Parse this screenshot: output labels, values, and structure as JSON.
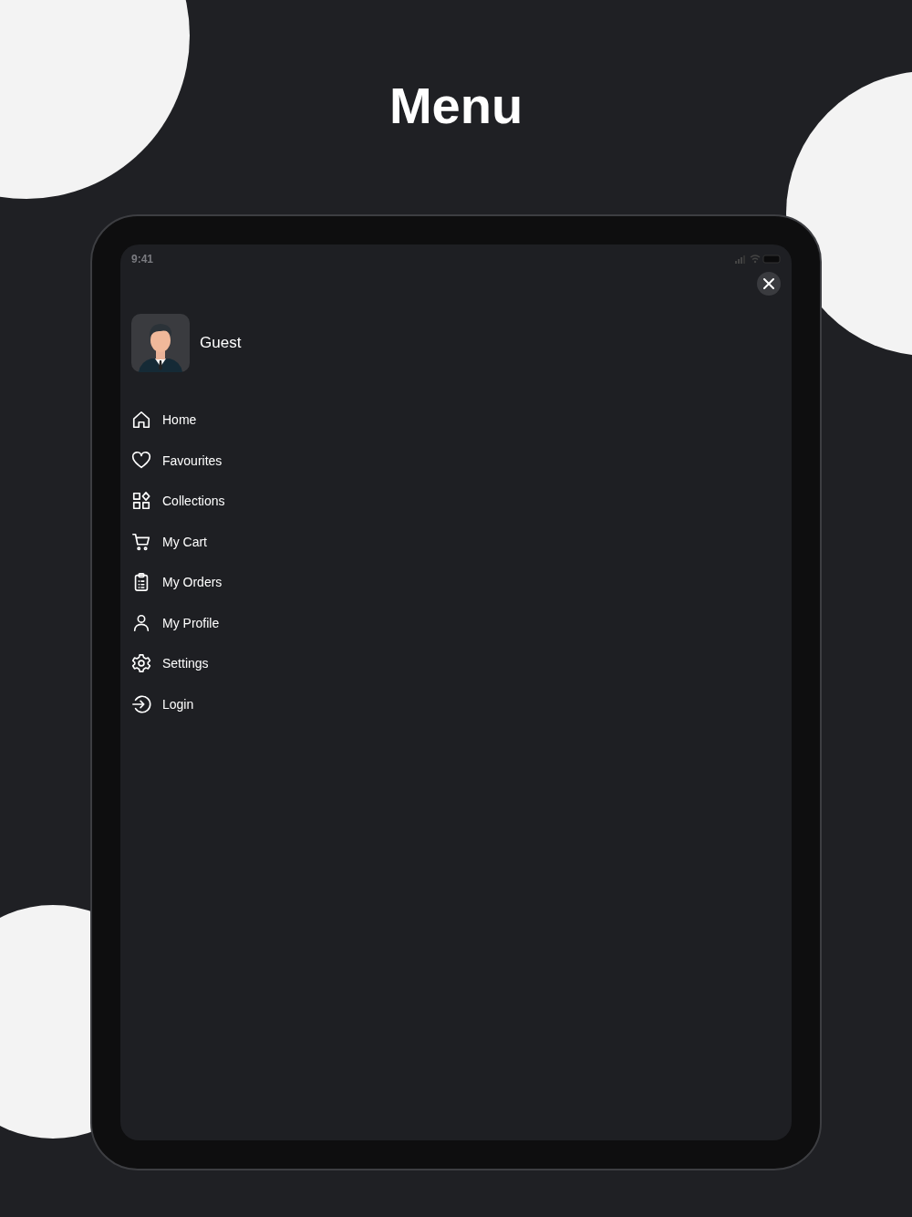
{
  "heading": "Menu",
  "status_bar": {
    "time": "9:41"
  },
  "user": {
    "name": "Guest"
  },
  "menu": [
    {
      "label": "Home",
      "kind": "home"
    },
    {
      "label": "Favourites",
      "kind": "heart"
    },
    {
      "label": "Collections",
      "kind": "grid"
    },
    {
      "label": "My Cart",
      "kind": "cart"
    },
    {
      "label": "My Orders",
      "kind": "clipboard"
    },
    {
      "label": "My Profile",
      "kind": "person"
    },
    {
      "label": "Settings",
      "kind": "gear"
    },
    {
      "label": "Login",
      "kind": "login"
    }
  ]
}
